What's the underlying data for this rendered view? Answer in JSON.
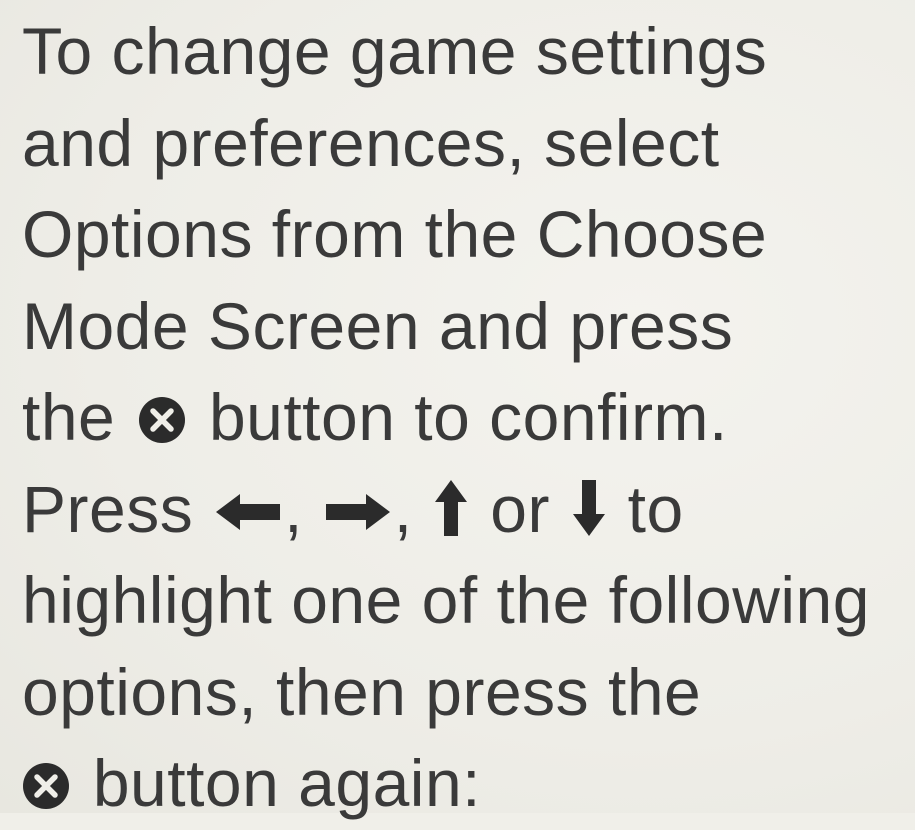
{
  "manual": {
    "line1": "To change game settings",
    "line2": "and preferences, select",
    "line3": "Options from the Choose",
    "line4": "Mode Screen and press",
    "line5_before": "the",
    "line5_after": "button to confirm.",
    "line6_before": "Press",
    "line6_sep1": ",",
    "line6_sep2": ",",
    "line6_or": "or",
    "line6_after": "to",
    "line7": "highlight one of the following",
    "line8": "options, then press the",
    "line9_after": "button again:"
  },
  "icons": {
    "confirm_button": "cross-button-icon",
    "left": "left-arrow-icon",
    "right": "right-arrow-icon",
    "up": "up-arrow-icon",
    "down": "down-arrow-icon"
  },
  "colors": {
    "text": "#3a3a3a",
    "icon": "#2b2b2b",
    "paper": "#f0efe9"
  }
}
